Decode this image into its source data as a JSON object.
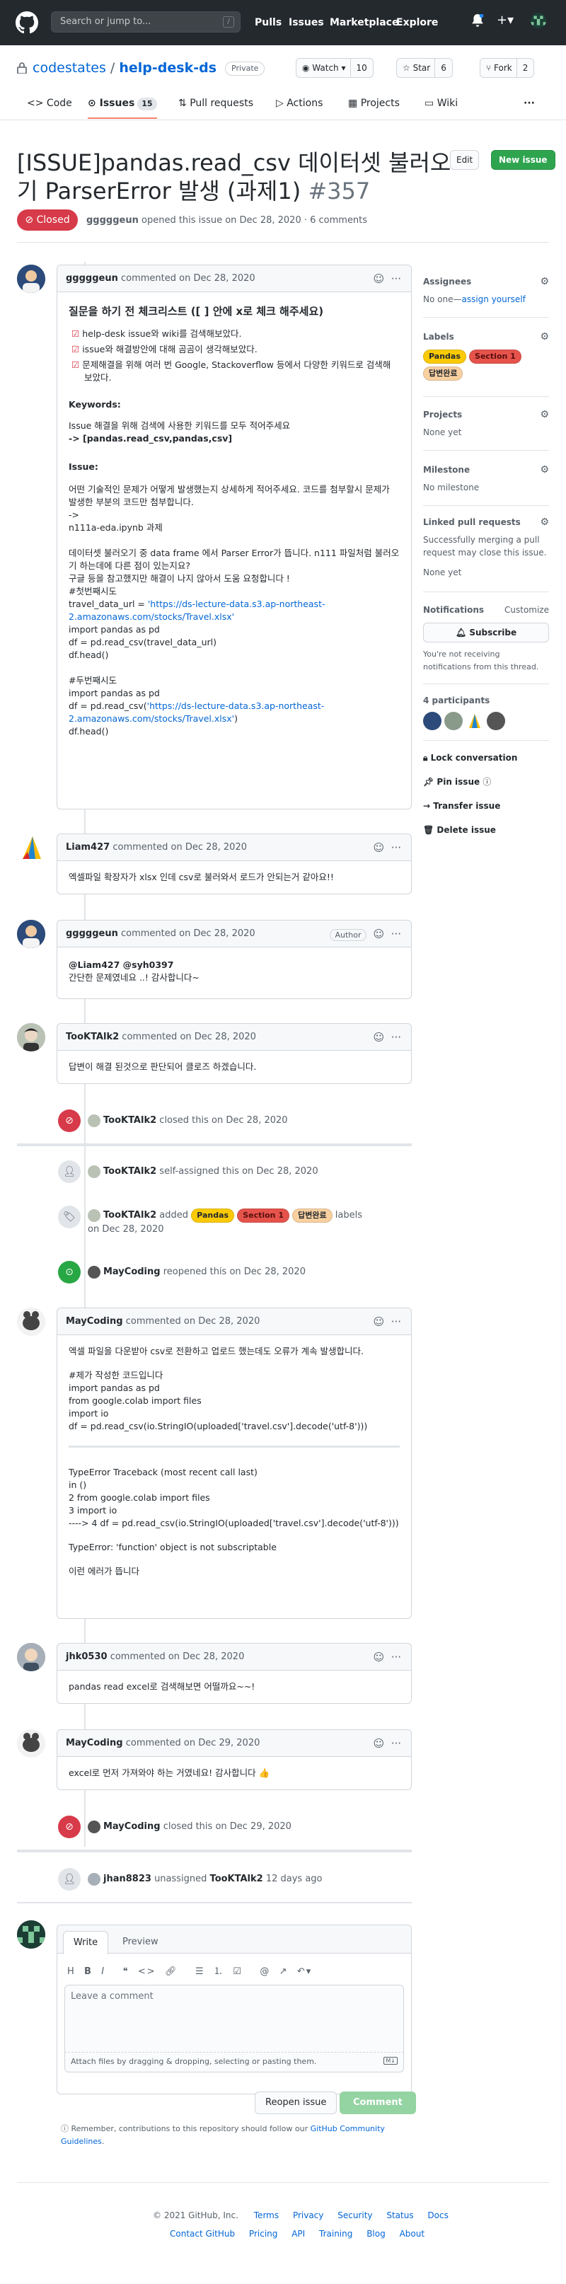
{
  "header": {
    "search_placeholder": "Search or jump to...",
    "slash_key": "/",
    "nav": [
      "Pulls",
      "Issues",
      "Marketplace",
      "Explore"
    ]
  },
  "repo": {
    "owner": "codestates",
    "separator": "/",
    "name": "help-desk-ds",
    "visibility": "Private",
    "watch_label": "Watch",
    "watch_count": "10",
    "star_label": "Star",
    "star_count": "6",
    "fork_label": "Fork",
    "fork_count": "2"
  },
  "tabs": [
    {
      "label": "Code"
    },
    {
      "label": "Issues",
      "count": "15"
    },
    {
      "label": "Pull requests"
    },
    {
      "label": "Actions"
    },
    {
      "label": "Projects"
    },
    {
      "label": "Wiki"
    }
  ],
  "issue": {
    "title": "[ISSUE]pandas.read_csv 데이터셋 불러오기 ParserError 발생 (과제1)",
    "number": "#357",
    "state": "Closed",
    "author": "gggggeun",
    "meta": "opened this issue on Dec 28, 2020 · 6 comments",
    "edit_label": "Edit",
    "new_issue_label": "New issue"
  },
  "c1": {
    "author": "gggggeun",
    "time": "commented on Dec 28, 2020",
    "heading": "질문을 하기 전 체크리스트 ([ ] 안에 x로 체크 해주세요)",
    "checks": [
      "help-desk issue와 wiki를 검색해보았다.",
      "issue와 해결방안에 대해 곰곰이 생각해보았다.",
      "문제해결을 위해 여러 번 Google, Stackoverflow 등에서 다양한 키워드로 검색해 보았다."
    ],
    "kw_title": "Keywords:",
    "kw_desc": "Issue 해결을 위해 검색에 사용한 키워드를 모두 적어주세요",
    "kw_value": "-> [pandas.read_csv,pandas,csv]",
    "issue_title": "Issue:",
    "issue_desc": "어떤 기술적인 문제가 어떻게 발생했는지 상세하게 적어주세요. 코드를 첨부할시 문제가 발생한 부분의 코드만 첨부합니다.",
    "arrow": "->",
    "file": "n111a-eda.ipynb 과제",
    "p2": "데이터셋 불러오기 중 data frame 에서 Parser Error가 뜹니다. n111 파일처럼 불러오기 하는데에 다른 점이 있는지요?",
    "p3": "구글 등을 참고했지만 해결이 나지 않아서 도움 요청합니다 !",
    "t1": "#첫번째시도",
    "l1a": "travel_data_url = ",
    "l1b": "'https://ds-lecture-data.s3.ap-northeast-2.amazonaws.com/stocks/Travel.xlsx'",
    "l2": "import pandas as pd",
    "l3": "df = pd.read_csv(travel_data_url)",
    "l4": "df.head()",
    "t2": "#두번째시도",
    "l5": "import pandas as pd",
    "l6a": "df = pd.read_csv(",
    "l6b": "'https://ds-lecture-data.s3.ap-northeast-2.amazonaws.com/stocks/Travel.xlsx'",
    "l6c": ")",
    "l7": "df.head()"
  },
  "c2": {
    "author": "Liam427",
    "time": "commented on Dec 28, 2020",
    "body": "엑셀파일 확장자가 xlsx 인데 csv로 불러와서 로드가 안되는거 같아요!!"
  },
  "c3": {
    "author": "gggggeun",
    "time": "commented on Dec 28, 2020",
    "badge": "Author",
    "mention": "@Liam427 @syh0397",
    "body": "간단한 문제였네요 ..! 감사합니다~"
  },
  "c4": {
    "author": "TooKTAlk2",
    "time": "commented on Dec 28, 2020",
    "body": "답변이 해결 된것으로 판단되어 클로즈 하겠습니다."
  },
  "e1": {
    "user": "TooKTAlk2",
    "text": "closed this on Dec 28, 2020"
  },
  "e2": {
    "user": "TooKTAlk2",
    "text": "self-assigned this on Dec 28, 2020"
  },
  "e3": {
    "user": "TooKTAlk2",
    "pre": "added",
    "post": "labels",
    "date": "on Dec 28, 2020"
  },
  "e4": {
    "user": "MayCoding",
    "text": "reopened this on Dec 28, 2020"
  },
  "c5": {
    "author": "MayCoding",
    "time": "commented on Dec 28, 2020",
    "intro": "엑셀 파일을 다운받아 csv로 전환하고 업로드 했는데도 오류가 계속 발생합니다.",
    "code": [
      "#제가 작성한 코드입니다",
      "import pandas as pd",
      "from google.colab import files",
      "import io",
      "df = pd.read_csv(io.StringIO(uploaded['travel.csv'].decode('utf-8')))"
    ],
    "trace": [
      "TypeError Traceback (most recent call last)",
      "in ()",
      "2 from google.colab import files",
      "3 import io",
      "----> 4 df = pd.read_csv(io.StringIO(uploaded['travel.csv'].decode('utf-8')))"
    ],
    "error": "TypeError: 'function' object is not subscriptable",
    "outro": "이런 에러가 뜹니다"
  },
  "c6": {
    "author": "jhk0530",
    "time": "commented on Dec 28, 2020",
    "body": "pandas read excel로 검색해보면 어떨까요~~!"
  },
  "c7": {
    "author": "MayCoding",
    "time": "commented on Dec 29, 2020",
    "body": "excel로 먼저 가져와야 하는 거였네요! 감사합니다 👍"
  },
  "e5": {
    "user": "MayCoding",
    "text": "closed this on Dec 29, 2020"
  },
  "e6": {
    "user": "jhan8823",
    "mid": "unassigned",
    "target": "TooKTAlk2",
    "date": "12 days ago"
  },
  "labels": [
    {
      "name": "Pandas",
      "color": "#fbca04"
    },
    {
      "name": "Section 1",
      "color": "#e5534b"
    },
    {
      "name": "답변완료",
      "color": "#f9d0a0"
    }
  ],
  "sidebar": {
    "assignees_h": "Assignees",
    "assignees_v": "No one—",
    "assign_link": "assign yourself",
    "labels_h": "Labels",
    "projects_h": "Projects",
    "projects_v": "None yet",
    "milestone_h": "Milestone",
    "milestone_v": "No milestone",
    "linked_h": "Linked pull requests",
    "linked_v": "Successfully merging a pull request may close this issue.",
    "linked_none": "None yet",
    "notif_h": "Notifications",
    "customize": "Customize",
    "subscribe": "Subscribe",
    "notif_v": "You're not receiving notifications from this thread.",
    "participants": "4 participants",
    "lock": "Lock conversation",
    "pin": "Pin issue",
    "transfer": "Transfer issue",
    "delete": "Delete issue"
  },
  "composer": {
    "write": "Write",
    "preview": "Preview",
    "placeholder": "Leave a comment",
    "attach": "Attach files by dragging & dropping, selecting or pasting them.",
    "reopen": "Reopen issue",
    "comment": "Comment",
    "note_pre": "Remember, contributions to this repository should follow our ",
    "note_link": "GitHub Community Guidelines",
    "note_post": "."
  },
  "footer": {
    "copyright": "© 2021 GitHub, Inc.",
    "row1": [
      "Terms",
      "Privacy",
      "Security",
      "Status",
      "Docs"
    ],
    "row2": [
      "Contact GitHub",
      "Pricing",
      "API",
      "Training",
      "Blog",
      "About"
    ]
  }
}
